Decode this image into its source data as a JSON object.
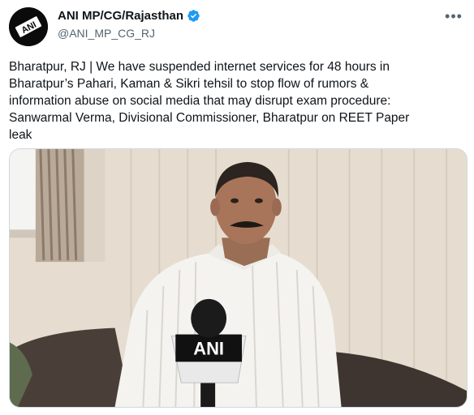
{
  "account": {
    "display_name": "ANI MP/CG/Rajasthan",
    "handle": "@ANI_MP_CG_RJ",
    "avatar_text": "ANI",
    "verified_icon": "verified-badge-icon",
    "more_icon": "more-options-icon"
  },
  "tweet": {
    "text": "Bharatpur, RJ | We have suspended internet services for 48 hours in\nBharatpur’s Pahari, Kaman & Sikri tehsil to stop flow of rumors &\ninformation abuse on social media that may disrupt exam procedure:\nSanwarmal Verma, Divisional Commissioner, Bharatpur on REET Paper\nleak"
  },
  "media": {
    "microphone_label": "ANI"
  },
  "colors": {
    "text": "#0f1419",
    "secondary_text": "#536471",
    "verified_blue": "#1d9bf0",
    "border": "#cfd9de"
  }
}
